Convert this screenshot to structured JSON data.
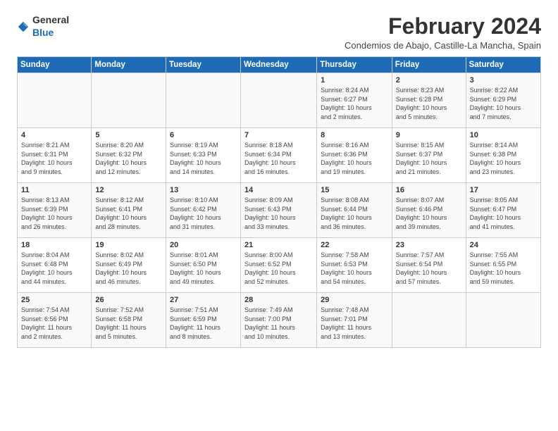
{
  "header": {
    "logo_general": "General",
    "logo_blue": "Blue",
    "title": "February 2024",
    "subtitle": "Condemios de Abajo, Castille-La Mancha, Spain"
  },
  "weekdays": [
    "Sunday",
    "Monday",
    "Tuesday",
    "Wednesday",
    "Thursday",
    "Friday",
    "Saturday"
  ],
  "weeks": [
    [
      {
        "day": "",
        "info": ""
      },
      {
        "day": "",
        "info": ""
      },
      {
        "day": "",
        "info": ""
      },
      {
        "day": "",
        "info": ""
      },
      {
        "day": "1",
        "info": "Sunrise: 8:24 AM\nSunset: 6:27 PM\nDaylight: 10 hours\nand 2 minutes."
      },
      {
        "day": "2",
        "info": "Sunrise: 8:23 AM\nSunset: 6:28 PM\nDaylight: 10 hours\nand 5 minutes."
      },
      {
        "day": "3",
        "info": "Sunrise: 8:22 AM\nSunset: 6:29 PM\nDaylight: 10 hours\nand 7 minutes."
      }
    ],
    [
      {
        "day": "4",
        "info": "Sunrise: 8:21 AM\nSunset: 6:31 PM\nDaylight: 10 hours\nand 9 minutes."
      },
      {
        "day": "5",
        "info": "Sunrise: 8:20 AM\nSunset: 6:32 PM\nDaylight: 10 hours\nand 12 minutes."
      },
      {
        "day": "6",
        "info": "Sunrise: 8:19 AM\nSunset: 6:33 PM\nDaylight: 10 hours\nand 14 minutes."
      },
      {
        "day": "7",
        "info": "Sunrise: 8:18 AM\nSunset: 6:34 PM\nDaylight: 10 hours\nand 16 minutes."
      },
      {
        "day": "8",
        "info": "Sunrise: 8:16 AM\nSunset: 6:36 PM\nDaylight: 10 hours\nand 19 minutes."
      },
      {
        "day": "9",
        "info": "Sunrise: 8:15 AM\nSunset: 6:37 PM\nDaylight: 10 hours\nand 21 minutes."
      },
      {
        "day": "10",
        "info": "Sunrise: 8:14 AM\nSunset: 6:38 PM\nDaylight: 10 hours\nand 23 minutes."
      }
    ],
    [
      {
        "day": "11",
        "info": "Sunrise: 8:13 AM\nSunset: 6:39 PM\nDaylight: 10 hours\nand 26 minutes."
      },
      {
        "day": "12",
        "info": "Sunrise: 8:12 AM\nSunset: 6:41 PM\nDaylight: 10 hours\nand 28 minutes."
      },
      {
        "day": "13",
        "info": "Sunrise: 8:10 AM\nSunset: 6:42 PM\nDaylight: 10 hours\nand 31 minutes."
      },
      {
        "day": "14",
        "info": "Sunrise: 8:09 AM\nSunset: 6:43 PM\nDaylight: 10 hours\nand 33 minutes."
      },
      {
        "day": "15",
        "info": "Sunrise: 8:08 AM\nSunset: 6:44 PM\nDaylight: 10 hours\nand 36 minutes."
      },
      {
        "day": "16",
        "info": "Sunrise: 8:07 AM\nSunset: 6:46 PM\nDaylight: 10 hours\nand 39 minutes."
      },
      {
        "day": "17",
        "info": "Sunrise: 8:05 AM\nSunset: 6:47 PM\nDaylight: 10 hours\nand 41 minutes."
      }
    ],
    [
      {
        "day": "18",
        "info": "Sunrise: 8:04 AM\nSunset: 6:48 PM\nDaylight: 10 hours\nand 44 minutes."
      },
      {
        "day": "19",
        "info": "Sunrise: 8:02 AM\nSunset: 6:49 PM\nDaylight: 10 hours\nand 46 minutes."
      },
      {
        "day": "20",
        "info": "Sunrise: 8:01 AM\nSunset: 6:50 PM\nDaylight: 10 hours\nand 49 minutes."
      },
      {
        "day": "21",
        "info": "Sunrise: 8:00 AM\nSunset: 6:52 PM\nDaylight: 10 hours\nand 52 minutes."
      },
      {
        "day": "22",
        "info": "Sunrise: 7:58 AM\nSunset: 6:53 PM\nDaylight: 10 hours\nand 54 minutes."
      },
      {
        "day": "23",
        "info": "Sunrise: 7:57 AM\nSunset: 6:54 PM\nDaylight: 10 hours\nand 57 minutes."
      },
      {
        "day": "24",
        "info": "Sunrise: 7:55 AM\nSunset: 6:55 PM\nDaylight: 10 hours\nand 59 minutes."
      }
    ],
    [
      {
        "day": "25",
        "info": "Sunrise: 7:54 AM\nSunset: 6:56 PM\nDaylight: 11 hours\nand 2 minutes."
      },
      {
        "day": "26",
        "info": "Sunrise: 7:52 AM\nSunset: 6:58 PM\nDaylight: 11 hours\nand 5 minutes."
      },
      {
        "day": "27",
        "info": "Sunrise: 7:51 AM\nSunset: 6:59 PM\nDaylight: 11 hours\nand 8 minutes."
      },
      {
        "day": "28",
        "info": "Sunrise: 7:49 AM\nSunset: 7:00 PM\nDaylight: 11 hours\nand 10 minutes."
      },
      {
        "day": "29",
        "info": "Sunrise: 7:48 AM\nSunset: 7:01 PM\nDaylight: 11 hours\nand 13 minutes."
      },
      {
        "day": "",
        "info": ""
      },
      {
        "day": "",
        "info": ""
      }
    ]
  ]
}
